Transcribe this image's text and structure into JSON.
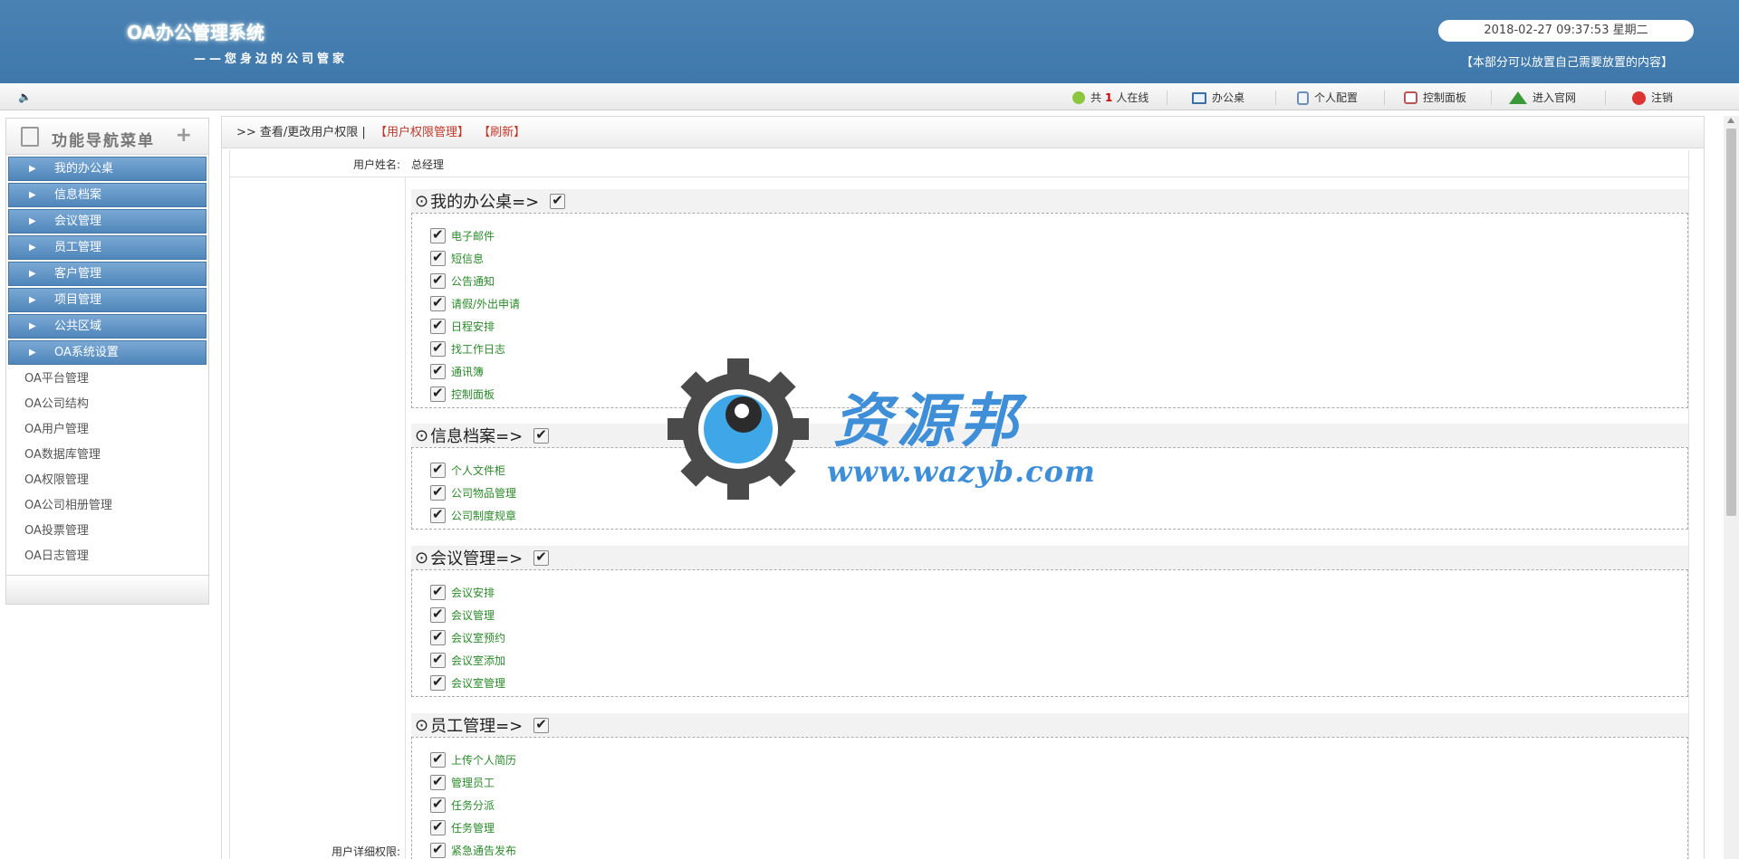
{
  "header": {
    "title": "OA办公管理系统",
    "subtitle": "——您身边的公司管家",
    "datetime": "2018-02-27 09:37:53 星期二",
    "note": "【本部分可以放置自己需要放置的内容】"
  },
  "toolbar": {
    "online_prefix": "共",
    "online_count": "1",
    "online_suffix": "人在线",
    "desk": "办公桌",
    "profile": "个人配置",
    "control": "控制面板",
    "site": "进入官网",
    "logout": "注销"
  },
  "sidebar": {
    "title": "功能导航菜单",
    "groups": [
      "我的办公桌",
      "信息档案",
      "会议管理",
      "员工管理",
      "客户管理",
      "项目管理",
      "公共区域",
      "OA系统设置"
    ],
    "subitems": [
      "OA平台管理",
      "OA公司结构",
      "OA用户管理",
      "OA数据库管理",
      "OA权限管理",
      "OA公司相册管理",
      "OA投票管理",
      "OA日志管理"
    ]
  },
  "breadcrumb": {
    "text": ">> 查看/更改用户权限 |",
    "link1": "【用户权限管理】",
    "link2": "【刷新】"
  },
  "form": {
    "name_label": "用户姓名:",
    "name_value": "总经理",
    "detail_label": "用户详细权限:"
  },
  "sections": [
    {
      "title": "我的办公桌=>",
      "items": [
        "电子邮件",
        "短信息",
        "公告通知",
        "请假/外出申请",
        "日程安排",
        "找工作日志",
        "通讯簿",
        "控制面板"
      ]
    },
    {
      "title": "信息档案=>",
      "items": [
        "个人文件柜",
        "公司物品管理",
        "公司制度规章"
      ]
    },
    {
      "title": "会议管理=>",
      "items": [
        "会议安排",
        "会议管理",
        "会议室预约",
        "会议室添加",
        "会议室管理"
      ]
    },
    {
      "title": "员工管理=>",
      "items": [
        "上传个人简历",
        "管理员工",
        "任务分派",
        "任务管理",
        "紧急通告发布"
      ]
    }
  ],
  "watermark": {
    "name": "资源邦",
    "url": "www.wazyb.com"
  }
}
